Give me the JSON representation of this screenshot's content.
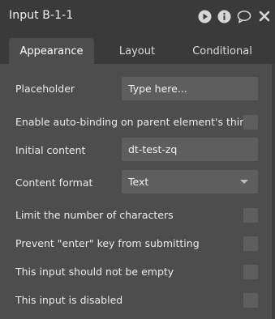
{
  "window": {
    "title": "Input B-1-1"
  },
  "header_icons": [
    "play-icon",
    "info-icon",
    "comment-icon",
    "close-icon"
  ],
  "tabs": [
    {
      "label": "Appearance",
      "active": true
    },
    {
      "label": "Layout",
      "active": false
    },
    {
      "label": "Conditional",
      "active": false
    }
  ],
  "fields": {
    "placeholder": {
      "label": "Placeholder",
      "value": "Type here..."
    },
    "auto_binding": {
      "label": "Enable auto-binding on parent element's thing",
      "checked": false
    },
    "initial_content": {
      "label": "Initial content",
      "value": "dt-test-zq"
    },
    "content_format": {
      "label": "Content format",
      "value": "Text"
    },
    "limit_chars": {
      "label": "Limit the number of characters",
      "checked": false
    },
    "prevent_enter": {
      "label": "Prevent \"enter\" key from submitting",
      "checked": false
    },
    "not_empty": {
      "label": "This input should not be empty",
      "checked": false
    },
    "disabled": {
      "label": "This input is disabled",
      "checked": false
    }
  },
  "colors": {
    "header_bg": "#3a3a3a",
    "panel_bg": "#4d4d4d",
    "field_bg": "#5e5e5e"
  }
}
